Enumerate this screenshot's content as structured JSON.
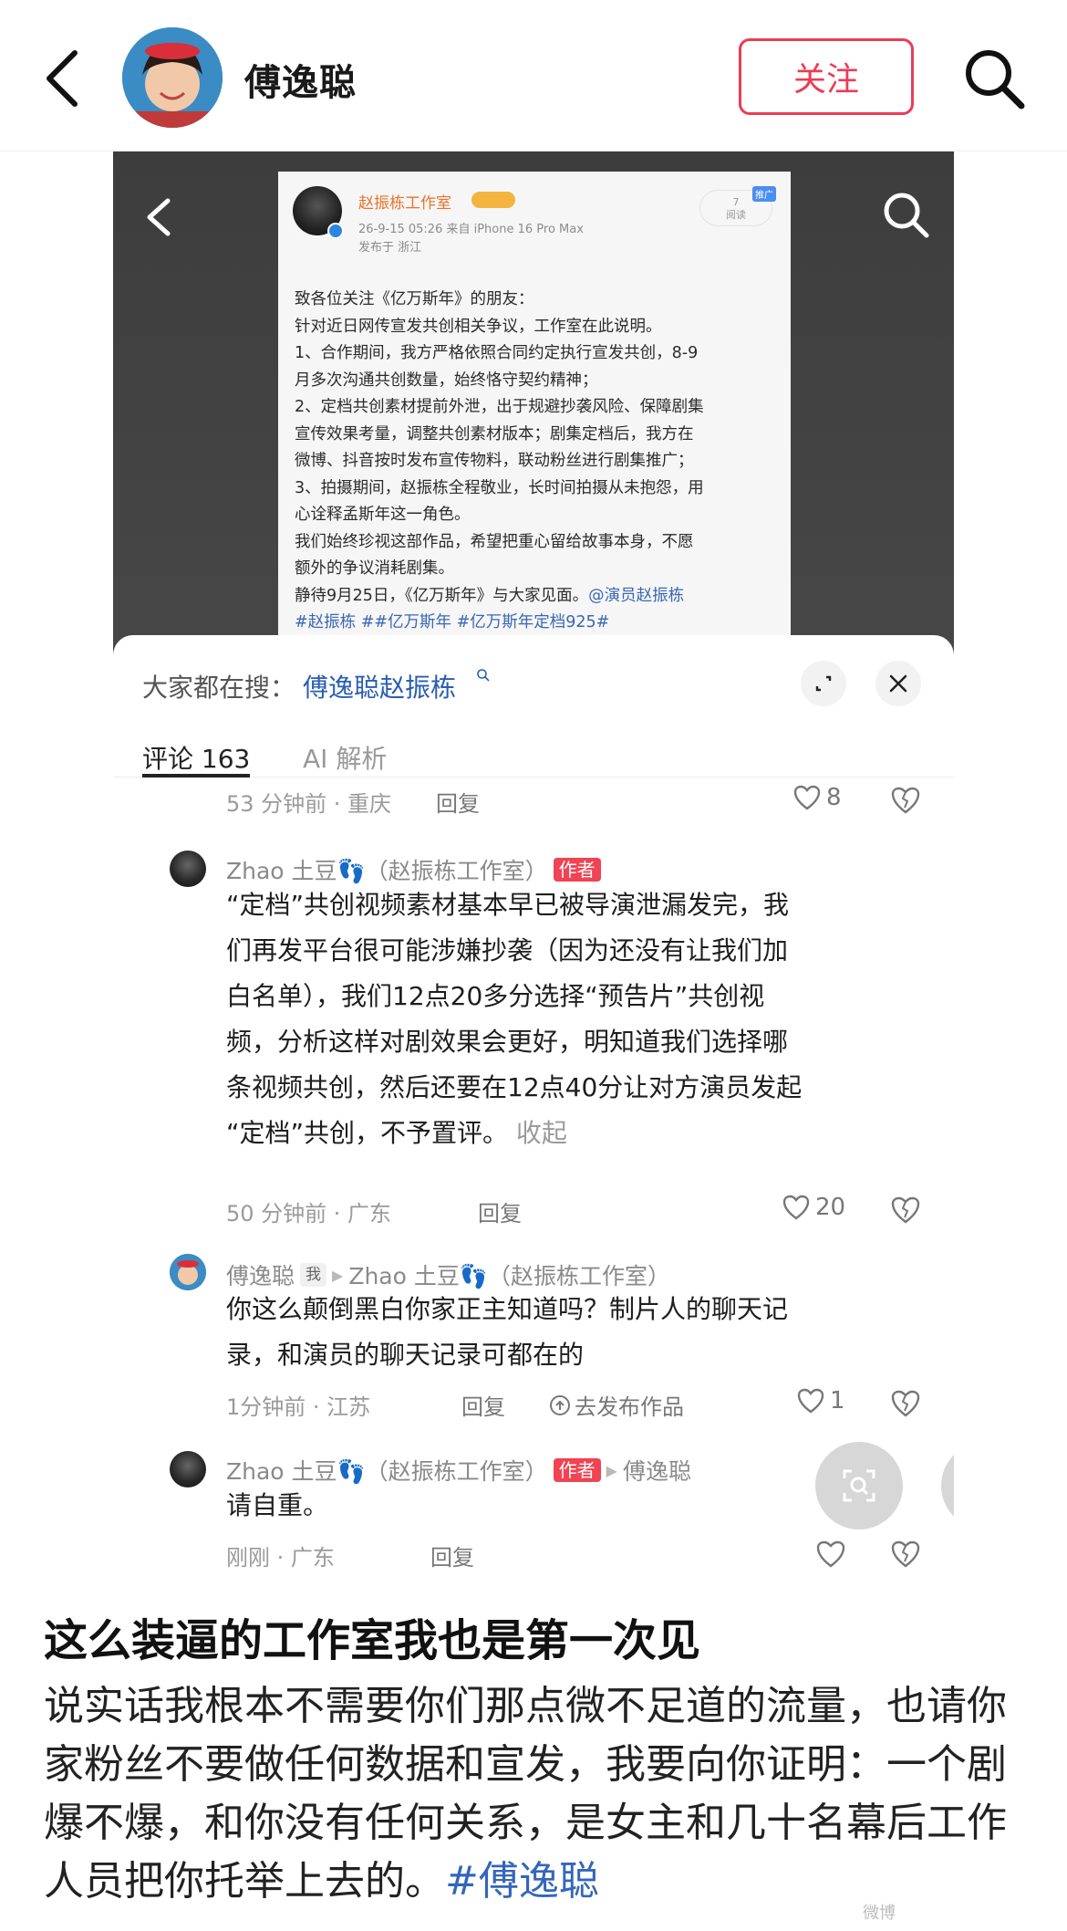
{
  "header": {
    "name": "傅逸聪",
    "follow_label": "关注"
  },
  "embedded_post": {
    "author": "赵振栋工作室",
    "meta": "26-9-15 05:26  来自 iPhone 16 Pro Max",
    "location": "发布于 浙江",
    "read_count": "7",
    "read_label": "阅读",
    "promo_tag": "推广",
    "lines": [
      "致各位关注《亿万斯年》的朋友：",
      "针对近日网传宣发共创相关争议，工作室在此说明。",
      "1、合作期间，我方严格依照合同约定执行宣发共创，8-9",
      "月多次沟通共创数量，始终恪守契约精神；",
      "2、定档共创素材提前外泄，出于规避抄袭风险、保障剧集",
      "宣传效果考量，调整共创素材版本；剧集定档后，我方在",
      "微博、抖音按时发布宣传物料，联动粉丝进行剧集推广；",
      "3、拍摄期间，赵振栋全程敬业，长时间拍摄从未抱怨，用",
      "心诠释孟斯年这一角色。",
      "我们始终珍视这部作品，希望把重心留给故事本身，不愿",
      "额外的争议消耗剧集。"
    ],
    "last_line_text": "静待9月25日，《亿万斯年》与大家见面。",
    "last_line_mention": "@演员赵振栋",
    "hashtags": "#赵振栋 ##亿万斯年 #亿万斯年定档925#"
  },
  "sheet": {
    "everyone_label": "大家都在搜：",
    "everyone_link": "傅逸聪赵振栋",
    "tabs": [
      "评论 163",
      "AI 解析"
    ]
  },
  "comments": {
    "c0": {
      "meta": "53 分钟前 · 重庆",
      "reply": "回复",
      "likes": "8"
    },
    "c1": {
      "name": "Zhao 土豆👣（赵振栋工作室）",
      "tag": "作者",
      "lines": [
        "“定档”共创视频素材基本早已被导演泄漏发完，我",
        "们再发平台很可能涉嫌抄袭（因为还没有让我们加",
        "白名单），我们12点20多分选择“预告片”共创视",
        "频，分析这样对剧效果会更好，明知道我们选择哪",
        "条视频共创，然后还要在12点40分让对方演员发起"
      ],
      "last_line": "“定档”共创，不予置评。",
      "collapse": "收起",
      "meta": "50 分钟前 · 广东",
      "reply": "回复",
      "likes": "20"
    },
    "c2": {
      "name": "傅逸聪",
      "me_tag": "我",
      "target": "Zhao 土豆👣（赵振栋工作室）",
      "lines": [
        "你这么颠倒黑白你家正主知道吗？制片人的聊天记",
        "录，和演员的聊天记录可都在的"
      ],
      "meta": "1分钟前 · 江苏",
      "reply": "回复",
      "publish": "去发布作品",
      "likes": "1"
    },
    "c3": {
      "name": "Zhao 土豆👣（赵振栋工作室）",
      "tag": "作者",
      "target": "傅逸聪",
      "text": "请自重。",
      "meta": "刚刚 · 广东",
      "reply": "回复"
    }
  },
  "post": {
    "title": "这么装逼的工作室我也是第一次见",
    "body": "说实话我根本不需要你们那点微不足道的流量，也请你家粉丝不要做任何数据和宣发，我要向你证明：一个剧爆不爆，和你没有任何关系，是女主和几十名幕后工作人员把你托举上去的。",
    "hashtag": "#傅逸聪",
    "watermark": "微博"
  },
  "colors": {
    "accent_red": "#ec3c55",
    "link_blue": "#2a5db0",
    "author_tag": "#f04353"
  },
  "icons": [
    "back-arrow-icon",
    "search-icon",
    "expand-icon",
    "close-icon",
    "heart-icon",
    "broken-heart-icon",
    "screen-search-icon",
    "pause-icon"
  ]
}
